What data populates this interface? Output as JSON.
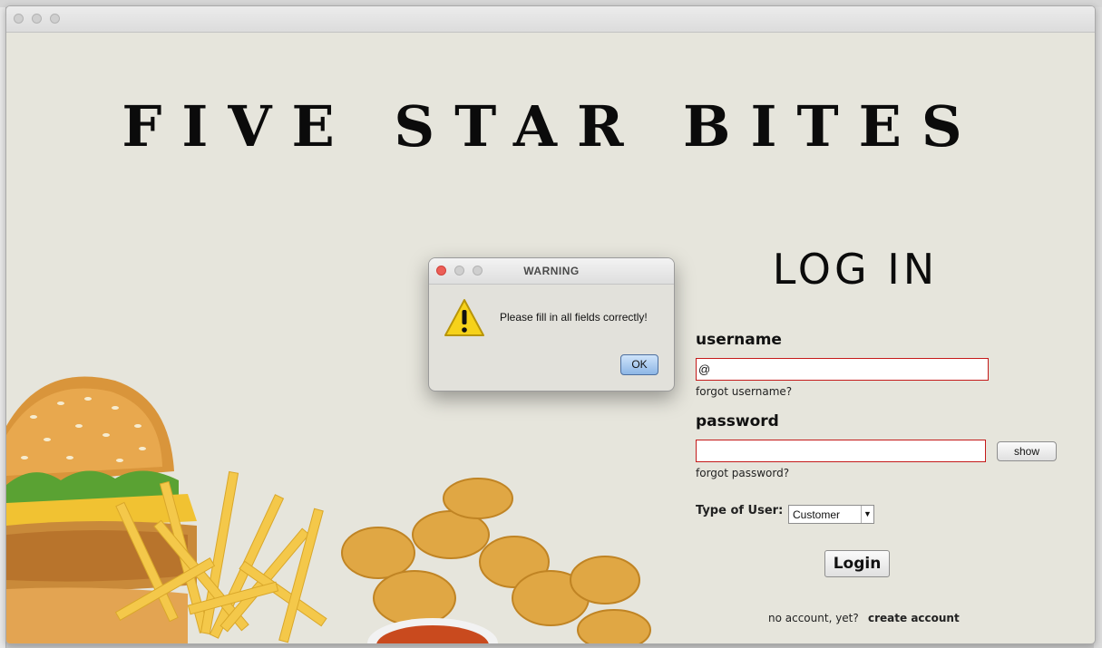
{
  "brand_title": "FIVE STAR BITES",
  "login_title": "LOG IN",
  "username": {
    "label": "username",
    "value": "@",
    "forgot_link": "forgot username?"
  },
  "password": {
    "label": "password",
    "value": "",
    "show_button": "show",
    "forgot_link": "forgot password?"
  },
  "user_type": {
    "label": "Type of User:",
    "selected": "Customer"
  },
  "login_button": "Login",
  "no_account_text": "no account, yet?",
  "create_account_link": "create account",
  "dialog": {
    "title": "WARNING",
    "message": "Please fill in all fields correctly!",
    "ok_button": "OK"
  },
  "colors": {
    "window_bg": "#e6e5dc",
    "error_border": "#c41a1a",
    "warning_yellow": "#f6d21a"
  }
}
